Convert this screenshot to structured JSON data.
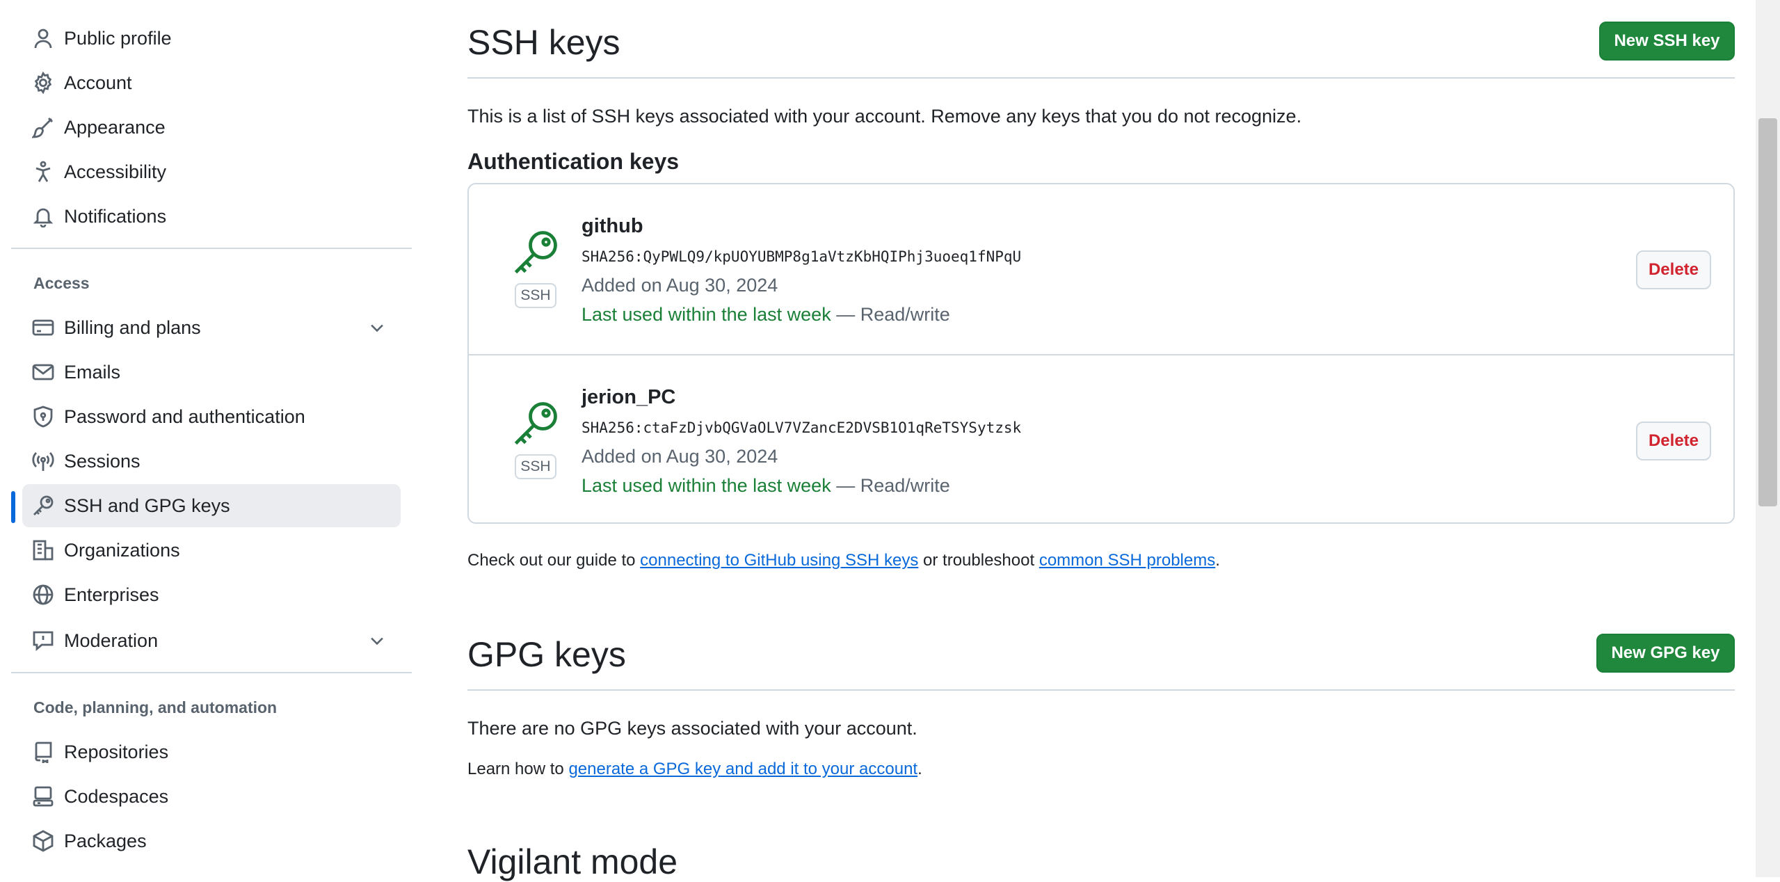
{
  "sidebar": {
    "items_top": [
      {
        "label": "Public profile",
        "icon": "person-icon"
      },
      {
        "label": "Account",
        "icon": "gear-icon"
      },
      {
        "label": "Appearance",
        "icon": "paintbrush-icon"
      },
      {
        "label": "Accessibility",
        "icon": "accessibility-icon"
      },
      {
        "label": "Notifications",
        "icon": "bell-icon"
      }
    ],
    "access_heading": "Access",
    "items_access": [
      {
        "label": "Billing and plans",
        "icon": "credit-card-icon"
      },
      {
        "label": "Emails",
        "icon": "mail-icon"
      },
      {
        "label": "Password and authentication",
        "icon": "shield-lock-icon"
      },
      {
        "label": "Sessions",
        "icon": "broadcast-icon"
      },
      {
        "label": "SSH and GPG keys",
        "icon": "key-icon"
      },
      {
        "label": "Organizations",
        "icon": "organization-icon"
      },
      {
        "label": "Enterprises",
        "icon": "globe-icon"
      },
      {
        "label": "Moderation",
        "icon": "report-icon"
      }
    ],
    "code_heading": "Code, planning, and automation",
    "items_code": [
      {
        "label": "Repositories",
        "icon": "repo-icon"
      },
      {
        "label": "Codespaces",
        "icon": "codespaces-icon"
      },
      {
        "label": "Packages",
        "icon": "package-icon"
      }
    ]
  },
  "ssh": {
    "title": "SSH keys",
    "new_button": "New SSH key",
    "description": "This is a list of SSH keys associated with your account. Remove any keys that you do not recognize.",
    "auth_heading": "Authentication keys",
    "keys": [
      {
        "name": "github",
        "fingerprint": "SHA256:QyPWLQ9/kpUOYUBMP8g1aVtzKbHQIPhj3uoeq1fNPqU",
        "added": "Added on Aug 30, 2024",
        "last_used": "Last used within the last week",
        "access": " — Read/write",
        "badge": "SSH",
        "delete": "Delete"
      },
      {
        "name": "jerion_PC",
        "fingerprint": "SHA256:ctaFzDjvbQGVaOLV7VZancE2DVSB1O1qReTSYSytzsk",
        "added": "Added on Aug 30, 2024",
        "last_used": "Last used within the last week",
        "access": " — Read/write",
        "badge": "SSH",
        "delete": "Delete"
      }
    ],
    "guide_prefix": "Check out our guide to ",
    "guide_link": "connecting to GitHub using SSH keys",
    "guide_middle": " or troubleshoot ",
    "guide_link2": "common SSH problems",
    "guide_suffix": "."
  },
  "gpg": {
    "title": "GPG keys",
    "new_button": "New GPG key",
    "empty": "There are no GPG keys associated with your account.",
    "learn_prefix": "Learn how to ",
    "learn_link": "generate a GPG key and add it to your account",
    "learn_suffix": "."
  },
  "vigilant": {
    "title": "Vigilant mode"
  },
  "colors": {
    "accent": "#0969da",
    "primary_button": "#1f883d",
    "danger": "#d1242f",
    "success_text": "#1a7f37"
  }
}
